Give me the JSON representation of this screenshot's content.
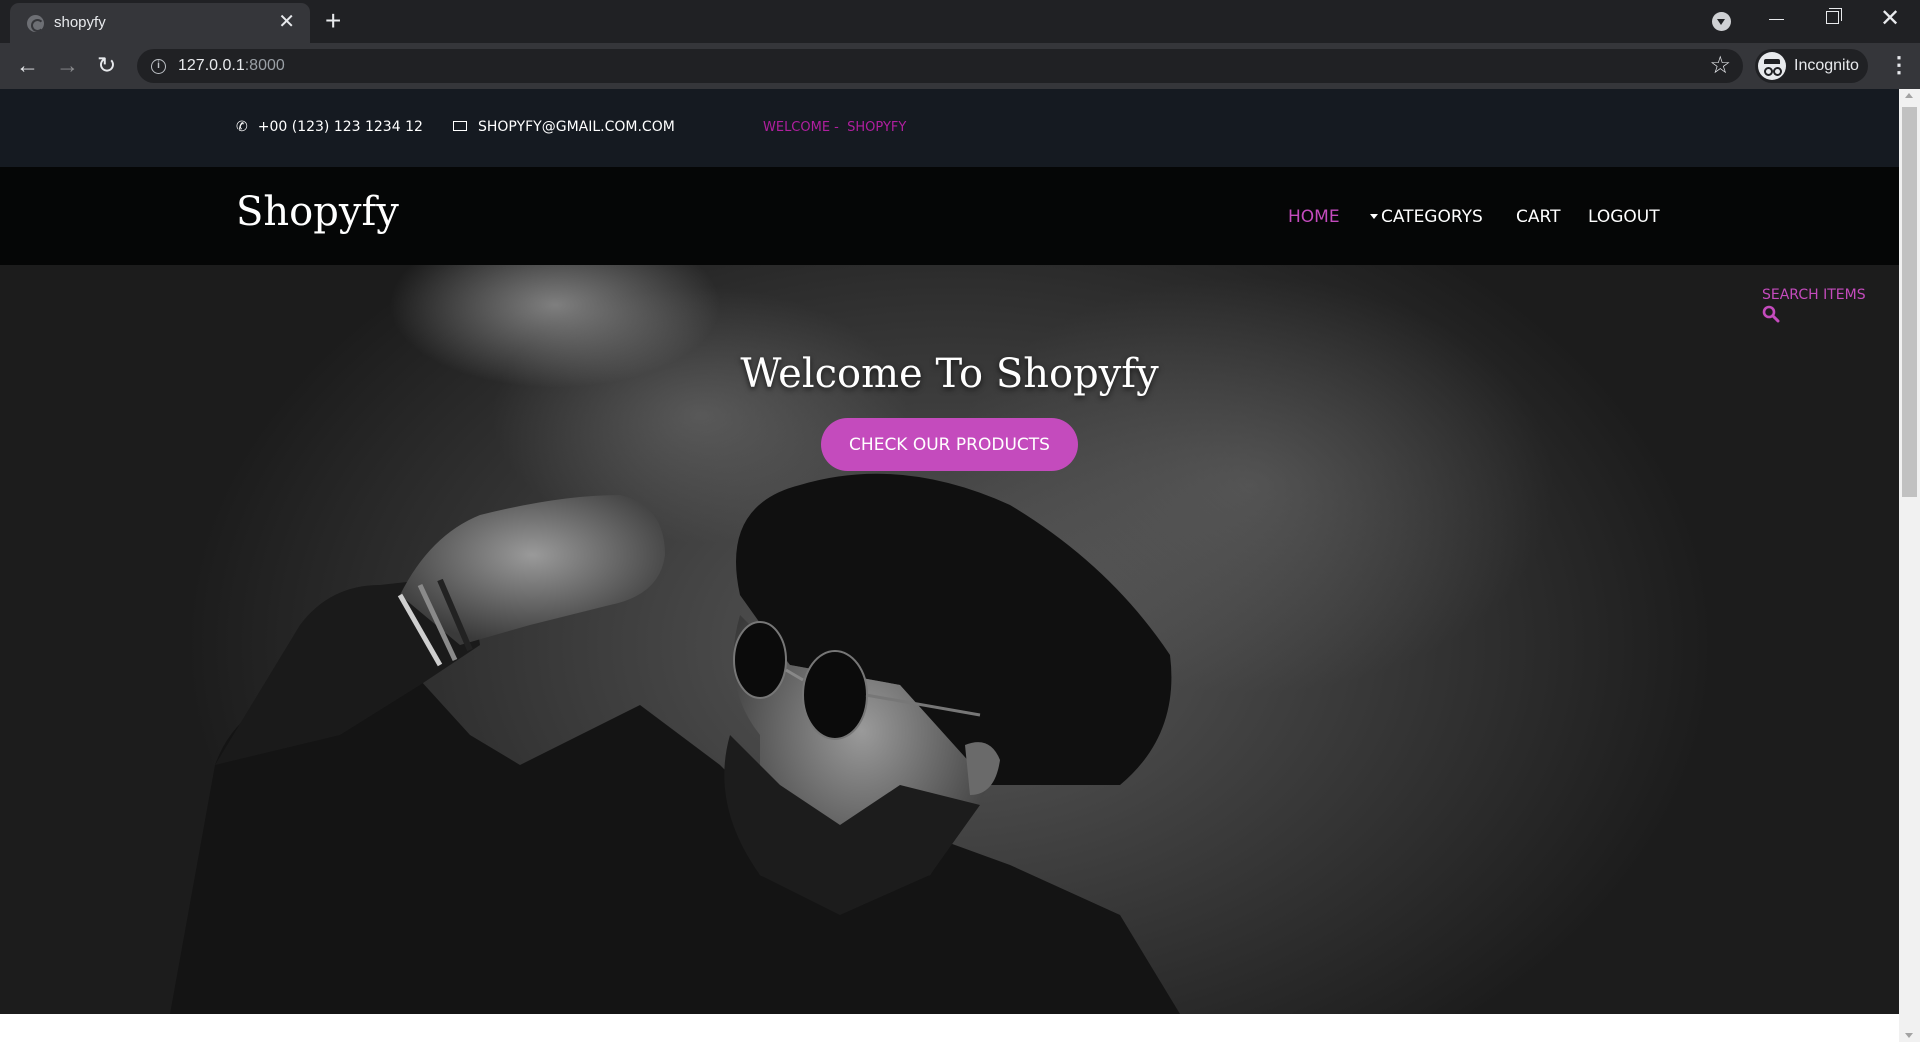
{
  "browser": {
    "tab_title": "shopyfy",
    "url_host": "127.0.0.1",
    "url_port": ":8000",
    "profile_label": "Incognito"
  },
  "topbar": {
    "phone": "+00 (123) 123 1234 12",
    "email": "SHOPYFY@GMAIL.COM.COM",
    "welcome": "WELCOME -  SHOPYFY"
  },
  "nav": {
    "brand": "Shopyfy",
    "home": "HOME",
    "categories": "CATEGORYS",
    "cart": "CART",
    "logout": "LOGOUT"
  },
  "hero": {
    "search_label": "SEARCH ITEMS",
    "title": "Welcome To Shopyfy",
    "cta": "CHECK OUR PRODUCTS"
  },
  "colors": {
    "accent": "#c44bbd",
    "welcome_text": "#b01f9f",
    "topbar_bg": "#151a21",
    "nav_bg": "#050606"
  },
  "icons": [
    "phone-icon",
    "mail-icon",
    "search-icon",
    "caret-down-icon"
  ]
}
